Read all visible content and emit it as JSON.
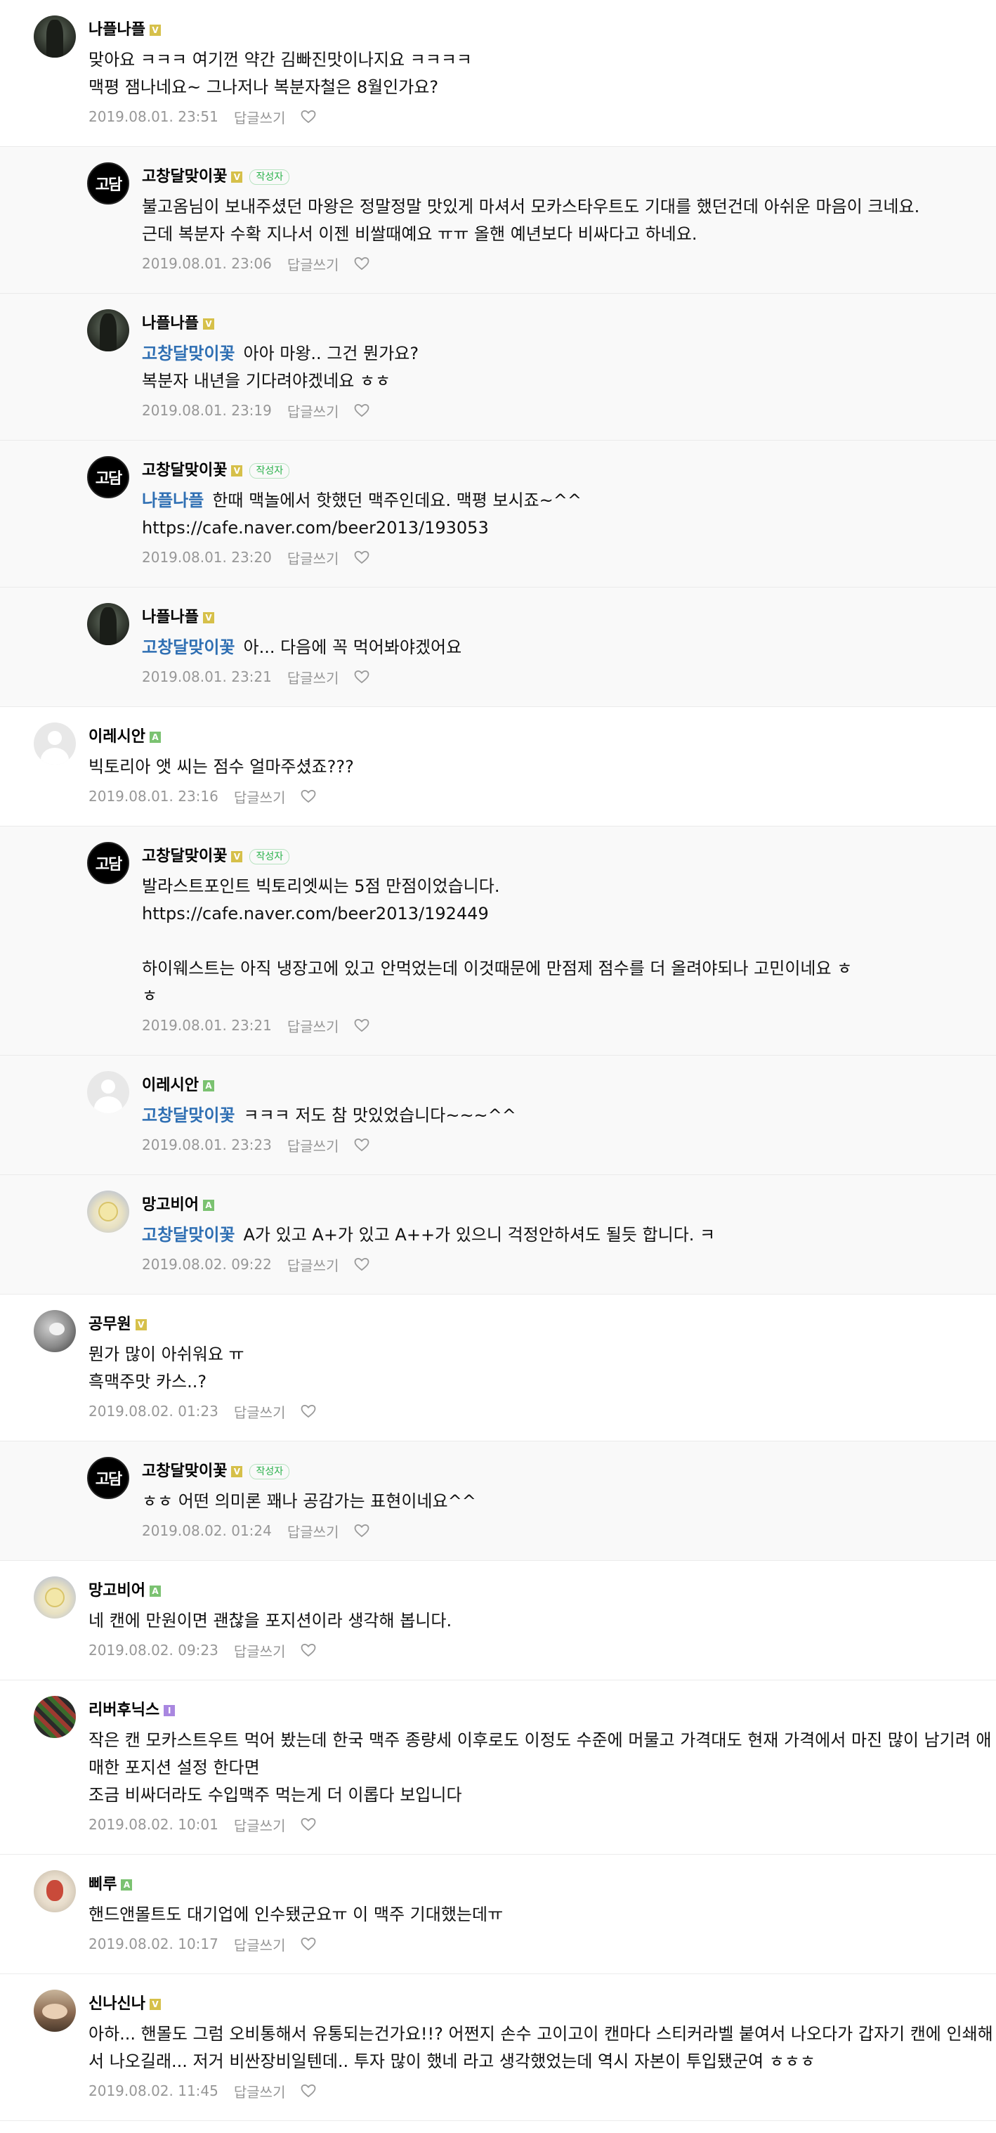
{
  "labels": {
    "reply_action": "답글쓰기",
    "author_tag": "작성자"
  },
  "comments": [
    {
      "type": "top",
      "avatar": "naple-avatar",
      "nick": "나플나플",
      "grade": "gold",
      "lines": [
        "맞아요 ㅋㅋㅋ 여기껀 약간 김빠진맛이나지요 ㅋㅋㅋㅋ",
        "맥평 잼나네요~ 그나저나 복분자철은 8월인가요?"
      ],
      "date": "2019.08.01. 23:51"
    },
    {
      "type": "reply",
      "avatar": "gochang-avatar",
      "logo": "고담",
      "nick": "고창달맞이꽃",
      "grade": "gold",
      "author": true,
      "lines": [
        "불고옴님이 보내주셨던 마왕은 정말정말 맛있게 마셔서 모카스타우트도 기대를 했던건데 아쉬운 마음이 크네요.",
        "근데 복분자 수확 지나서 이젠 비쌀때예요 ㅠㅠ 올핸 예년보다 비싸다고 하네요."
      ],
      "date": "2019.08.01. 23:06"
    },
    {
      "type": "reply",
      "avatar": "naple-avatar",
      "nick": "나플나플",
      "grade": "gold",
      "mention": "고창달맞이꽃",
      "lines": [
        "아아 마왕.. 그건 뭔가요?",
        "복분자 내년을 기다려야겠네요 ㅎㅎ"
      ],
      "date": "2019.08.01. 23:19"
    },
    {
      "type": "reply",
      "avatar": "gochang-avatar",
      "logo": "고담",
      "nick": "고창달맞이꽃",
      "grade": "gold",
      "author": true,
      "mention": "나플나플",
      "lines": [
        "한때 맥놀에서 핫했던 맥주인데요. 맥평 보시죠~^^",
        "https://cafe.naver.com/beer2013/193053"
      ],
      "date": "2019.08.01. 23:20"
    },
    {
      "type": "reply",
      "avatar": "naple-avatar",
      "nick": "나플나플",
      "grade": "gold",
      "mention": "고창달맞이꽃",
      "lines": [
        "아... 다음에 꼭 먹어봐야겠어요"
      ],
      "date": "2019.08.01. 23:21"
    },
    {
      "type": "top",
      "avatar": "default-avatar",
      "nick": "이레시안",
      "grade": "green",
      "lines": [
        "빅토리아 앳 씨는 점수 얼마주셨죠???"
      ],
      "date": "2019.08.01. 23:16"
    },
    {
      "type": "reply",
      "avatar": "gochang-avatar",
      "logo": "고담",
      "nick": "고창달맞이꽃",
      "grade": "gold",
      "author": true,
      "lines": [
        "발라스트포인트 빅토리엣씨는 5점 만점이었습니다.",
        "https://cafe.naver.com/beer2013/192449",
        "",
        "하이웨스트는 아직 냉장고에 있고 안먹었는데 이것때문에 만점제 점수를 더 올려야되나 고민이네요 ㅎ",
        "ㅎ"
      ],
      "date": "2019.08.01. 23:21"
    },
    {
      "type": "reply",
      "avatar": "default-avatar",
      "nick": "이레시안",
      "grade": "green",
      "mention": "고창달맞이꽃",
      "lines": [
        "ㅋㅋㅋ 저도 참 맛있었습니다~~~^^"
      ],
      "date": "2019.08.01. 23:23"
    },
    {
      "type": "reply",
      "avatar": "mango-avatar",
      "nick": "망고비어",
      "grade": "green",
      "mention": "고창달맞이꽃",
      "lines": [
        "A가 있고 A+가 있고 A++가 있으니 걱정안하셔도 될듯 합니다. ㅋ"
      ],
      "date": "2019.08.02. 09:22"
    },
    {
      "type": "top",
      "avatar": "gongmu-avatar",
      "nick": "공무원",
      "grade": "gold",
      "lines": [
        "뭔가 많이 아쉬워요 ㅠ",
        "흑맥주맛 카스..?"
      ],
      "date": "2019.08.02. 01:23"
    },
    {
      "type": "reply",
      "avatar": "gochang-avatar",
      "logo": "고담",
      "nick": "고창달맞이꽃",
      "grade": "gold",
      "author": true,
      "lines": [
        "ㅎㅎ 어떤 의미론 꽤나 공감가는 표현이네요^^"
      ],
      "date": "2019.08.02. 01:24"
    },
    {
      "type": "top",
      "avatar": "mango-avatar",
      "nick": "망고비어",
      "grade": "green",
      "lines": [
        "네 캔에 만원이면 괜찮을 포지션이라 생각해 봅니다."
      ],
      "date": "2019.08.02. 09:23"
    },
    {
      "type": "top",
      "avatar": "river-avatar",
      "nick": "리버후닉스",
      "grade": "purple",
      "lines": [
        "작은 캔 모카스트우트 먹어 봤는데 한국 맥주 종량세 이후로도 이정도 수준에 머물고 가격대도 현재 가격에서 마진 많이 남기려 애매한 포지션 설정 한다면",
        "조금 비싸더라도 수입맥주 먹는게 더 이롭다 보입니다"
      ],
      "date": "2019.08.02. 10:01"
    },
    {
      "type": "top",
      "avatar": "ppiru-avatar",
      "nick": "삐루",
      "grade": "green",
      "lines": [
        "핸드앤몰트도 대기업에 인수됐군요ㅠ 이 맥주 기대했는데ㅠ"
      ],
      "date": "2019.08.02. 10:17"
    },
    {
      "type": "top",
      "avatar": "shina-avatar",
      "nick": "신나신나",
      "grade": "gold",
      "lines": [
        "아하... 핸몰도 그럼 오비통해서 유통되는건가요!!? 어쩐지 손수 고이고이 캔마다 스티커라벨 붙여서 나오다가 갑자기 캔에 인쇄해서 나오길래... 저거 비싼장비일텐데.. 투자 많이 했네 라고 생각했었는데 역시 자본이 투입됐군여 ㅎㅎㅎ"
      ],
      "date": "2019.08.02. 11:45"
    }
  ]
}
